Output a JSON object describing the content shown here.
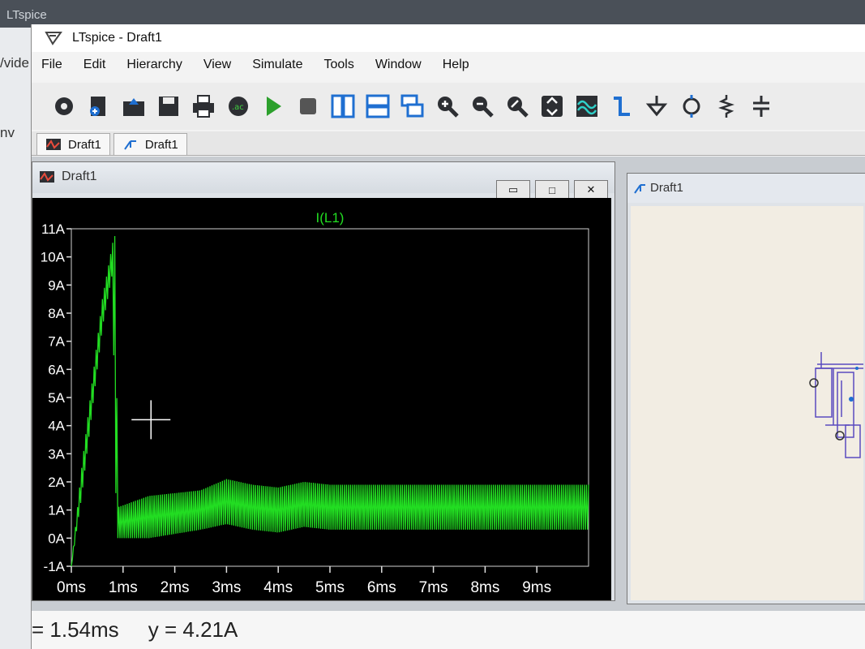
{
  "browser": {
    "tab_title": "LTspice",
    "side_texts": [
      "/vide",
      "nv"
    ]
  },
  "window": {
    "title": "LTspice - Draft1"
  },
  "menu": [
    "File",
    "Edit",
    "Hierarchy",
    "View",
    "Simulate",
    "Tools",
    "Window",
    "Help"
  ],
  "toolbar_icons": [
    "settings-icon",
    "new-schematic-icon",
    "open-icon",
    "save-icon",
    "print-icon",
    "ac-analysis-icon",
    "run-icon",
    "halt-icon",
    "tile-vertical-icon",
    "tile-horizontal-icon",
    "cascade-icon",
    "zoom-in-icon",
    "zoom-out-icon",
    "zoom-fit-icon",
    "pan-icon",
    "waveform-icon",
    "wire-icon",
    "ground-icon",
    "component-icon",
    "resistor-icon",
    "capacitor-icon"
  ],
  "tabs": [
    {
      "label": "Draft1",
      "icon": "waveform-tab-icon"
    },
    {
      "label": "Draft1",
      "icon": "schematic-tab-icon"
    }
  ],
  "waveform_window": {
    "title": "Draft1",
    "buttons": {
      "minimize": "▭",
      "restore": "□",
      "close": "✕"
    }
  },
  "schematic_window": {
    "title": "Draft1"
  },
  "chart_data": {
    "type": "line",
    "title": "I(L1)",
    "series": [
      {
        "name": "I(L1)",
        "color": "#22dd22"
      }
    ],
    "xlim": [
      0,
      10
    ],
    "ylim": [
      -1,
      11
    ],
    "x_ticks": [
      "0ms",
      "1ms",
      "2ms",
      "3ms",
      "4ms",
      "5ms",
      "6ms",
      "7ms",
      "8ms",
      "9ms"
    ],
    "y_ticks": [
      "11A",
      "10A",
      "9A",
      "8A",
      "7A",
      "6A",
      "5A",
      "4A",
      "3A",
      "2A",
      "1A",
      "0A",
      "-1A"
    ],
    "envelope": {
      "x": [
        0,
        0.2,
        0.4,
        0.6,
        0.8,
        0.85,
        0.9,
        1.5,
        2.5,
        3.0,
        3.5,
        4.0,
        4.5,
        5.0,
        6.0,
        7.0,
        8.0,
        9.0,
        10.0
      ],
      "upper": [
        -1,
        2.5,
        5.5,
        8.5,
        10.5,
        10.8,
        1.1,
        1.5,
        1.7,
        2.1,
        1.9,
        1.8,
        2.0,
        1.9,
        1.9,
        1.9,
        1.9,
        1.9,
        1.9
      ],
      "lower": [
        -1,
        1.5,
        4.5,
        7.5,
        9.5,
        2.0,
        0.0,
        0.0,
        0.3,
        0.5,
        0.3,
        0.2,
        0.4,
        0.3,
        0.3,
        0.3,
        0.3,
        0.3,
        0.3
      ]
    }
  },
  "status": {
    "text": "= 1.54ms     y = 4.21A"
  }
}
